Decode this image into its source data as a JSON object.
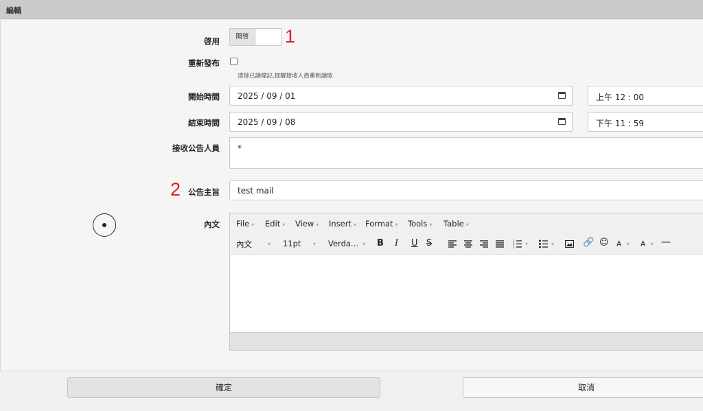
{
  "dialog": {
    "title": "編輯"
  },
  "form": {
    "enable_label": "啓用",
    "enable_toggle_text": "開啓",
    "republish_label": "重新發布",
    "republish_hint": "清除已讀標記,提醒接收人員重新讀取",
    "start_label": "開始時間",
    "start_date": "2025 / 09 / 01",
    "start_time": "上午 12 : 00",
    "end_label": "結束時間",
    "end_date": "2025 / 09 / 08",
    "end_time": "下午 11 : 59",
    "recipients_label": "接收公告人員",
    "recipients_value": "*",
    "subject_label": "公告主旨",
    "subject_value": "test mail",
    "content_label": "內文"
  },
  "annotations": {
    "first": "1",
    "second": "2"
  },
  "editor": {
    "menus": [
      "File",
      "Edit",
      "View",
      "Insert",
      "Format",
      "Tools",
      "Table"
    ],
    "block_format": "內文",
    "font_size": "11pt",
    "font_family": "Verda...",
    "bold": "B",
    "italic": "I",
    "underline": "U",
    "strike": "S",
    "text_color": "A",
    "bg_color": "A"
  },
  "buttons": {
    "ok": "確定",
    "cancel": "取消"
  },
  "colors": {
    "annotation": "#e02020",
    "titlebar": "#cbcbcb"
  }
}
